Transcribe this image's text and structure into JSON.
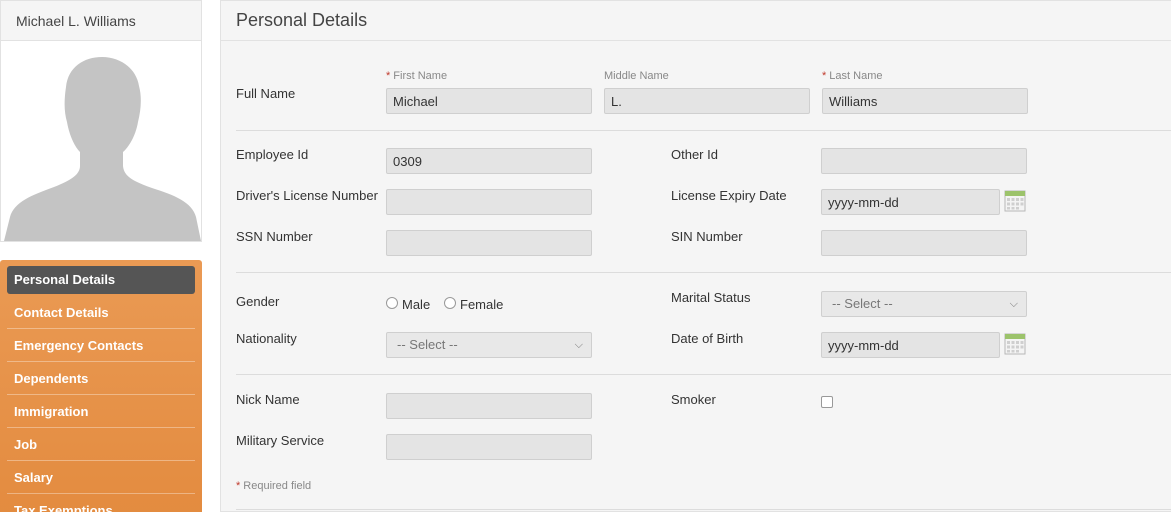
{
  "profile": {
    "name": "Michael L. Williams"
  },
  "sidebar": {
    "items": [
      {
        "label": "Personal Details",
        "active": true
      },
      {
        "label": "Contact Details"
      },
      {
        "label": "Emergency Contacts"
      },
      {
        "label": "Dependents"
      },
      {
        "label": "Immigration"
      },
      {
        "label": "Job"
      },
      {
        "label": "Salary"
      },
      {
        "label": "Tax Exemptions"
      }
    ]
  },
  "main": {
    "title": "Personal Details",
    "full_name": {
      "label": "Full Name",
      "first_label": "First Name",
      "first_value": "Michael",
      "middle_label": "Middle Name",
      "middle_value": "L.",
      "last_label": "Last Name",
      "last_value": "Williams"
    },
    "employee_id": {
      "label": "Employee Id",
      "value": "0309"
    },
    "other_id": {
      "label": "Other Id",
      "value": ""
    },
    "drivers_license": {
      "label": "Driver's License Number",
      "value": ""
    },
    "license_expiry": {
      "label": "License Expiry Date",
      "value": "yyyy-mm-dd"
    },
    "ssn": {
      "label": "SSN Number",
      "value": ""
    },
    "sin": {
      "label": "SIN Number",
      "value": ""
    },
    "gender": {
      "label": "Gender",
      "options": [
        "Male",
        "Female"
      ]
    },
    "marital_status": {
      "label": "Marital Status",
      "selected": "-- Select --"
    },
    "nationality": {
      "label": "Nationality",
      "selected": "-- Select --"
    },
    "dob": {
      "label": "Date of Birth",
      "value": "yyyy-mm-dd"
    },
    "nick_name": {
      "label": "Nick Name",
      "value": ""
    },
    "smoker": {
      "label": "Smoker",
      "checked": false
    },
    "military": {
      "label": "Military Service",
      "value": ""
    },
    "required_note": "Required field",
    "required_mark": "*"
  },
  "colors": {
    "accent": "#e8954a",
    "active_nav": "#555555",
    "required": "#c0392b"
  }
}
